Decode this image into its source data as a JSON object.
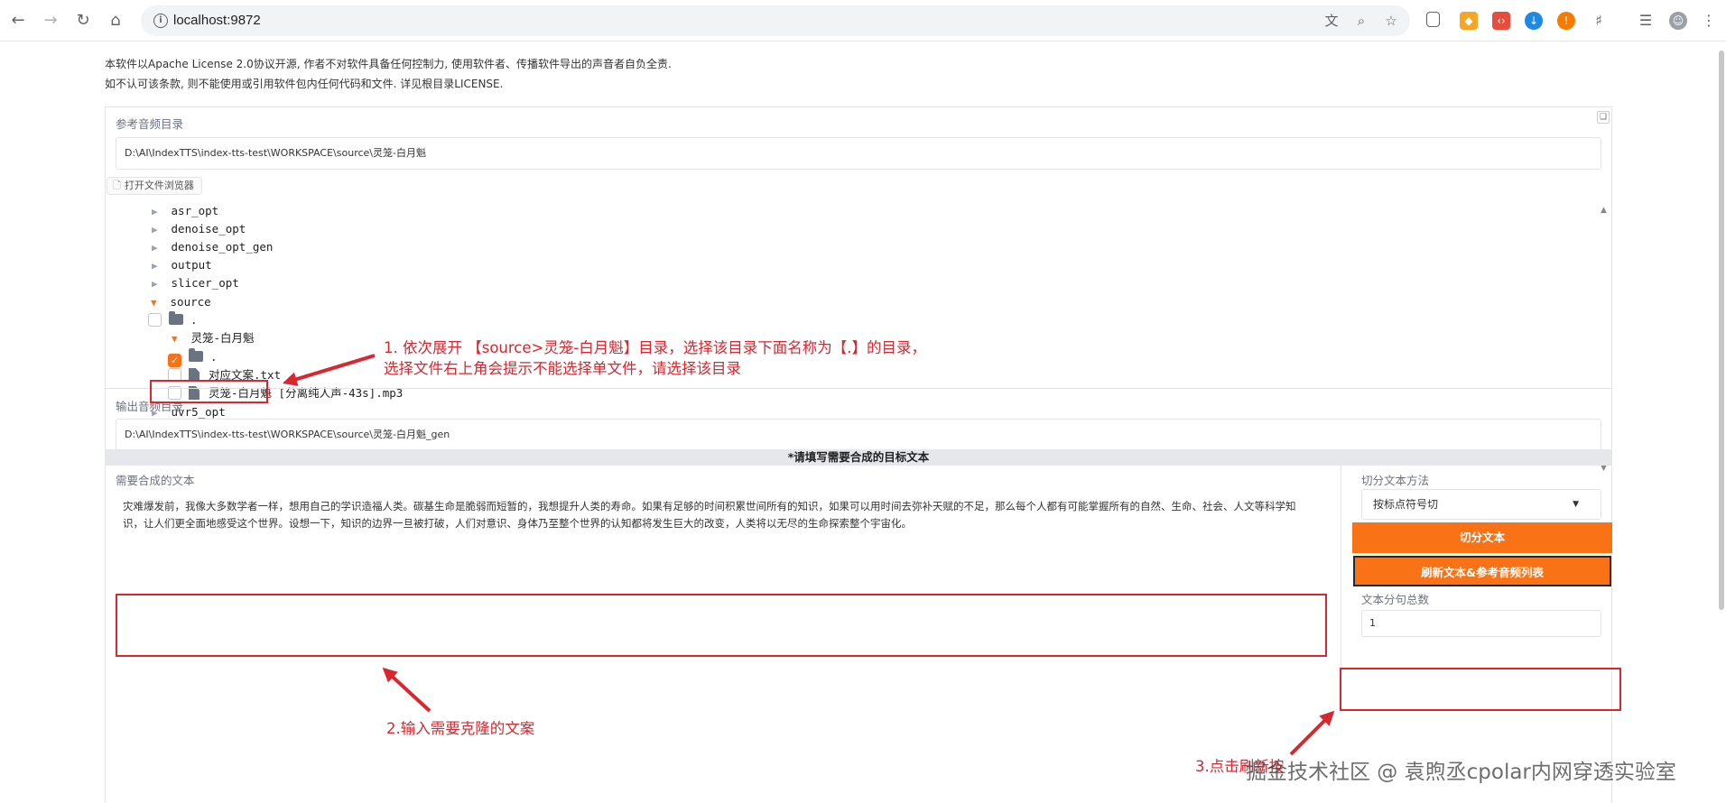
{
  "browser": {
    "url": "localhost:9872"
  },
  "license": {
    "line1": "本软件以Apache License 2.0协议开源, 作者不对软件具备任何控制力, 使用软件者、传播软件导出的声音者自负全责.",
    "line2": "如不认可该条款, 则不能使用或引用软件包内任何代码和文件. 详见根目录LICENSE."
  },
  "reference_dir": {
    "label": "参考音频目录",
    "value": "D:\\AI\\IndexTTS\\index-tts-test\\WORKSPACE\\source\\灵笼-白月魁",
    "browse_label": "打开文件浏览器"
  },
  "file_tree": [
    {
      "name": "asr_opt",
      "type": "collapsed"
    },
    {
      "name": "denoise_opt",
      "type": "collapsed"
    },
    {
      "name": "denoise_opt_gen",
      "type": "collapsed"
    },
    {
      "name": "output",
      "type": "collapsed"
    },
    {
      "name": "slicer_opt",
      "type": "collapsed"
    },
    {
      "name": "source",
      "type": "expanded"
    },
    {
      "name": ".",
      "type": "folder"
    },
    {
      "name": "灵笼-白月魁",
      "type": "expanded"
    },
    {
      "name": ".",
      "type": "folder-checked"
    },
    {
      "name": "对应文案.txt",
      "type": "file"
    },
    {
      "name": "灵笼-白月魁 [分离纯人声-43s].mp3",
      "type": "file"
    },
    {
      "name": "uvr5_opt",
      "type": "collapsed"
    }
  ],
  "output_dir": {
    "label": "输出音频目录",
    "value": "D:\\AI\\IndexTTS\\index-tts-test\\WORKSPACE\\source\\灵笼-白月魁_gen"
  },
  "section_title": "*请填写需要合成的目标文本",
  "synth_text": {
    "label": "需要合成的文本",
    "value": "灾难爆发前，我像大多数学者一样，想用自己的学识造福人类。碳基生命是脆弱而短暂的，我想提升人类的寿命。如果有足够的时间积累世间所有的知识，如果可以用时间去弥补天赋的不足，那么每个人都有可能掌握所有的自然、生命、社会、人文等科学知识，让人们更全面地感受这个世界。设想一下，知识的边界一旦被打破，人们对意识、身体乃至整个世界的认知都将发生巨大的改变，人类将以无尽的生命探索整个宇宙化。"
  },
  "split_method": {
    "label": "切分文本方法",
    "value": "按标点符号切"
  },
  "buttons": {
    "split": "切分文本",
    "refresh": "刷新文本&参考音频列表"
  },
  "segment_count": {
    "label": "文本分句总数",
    "value": "1"
  },
  "annotations": {
    "step1_line1": "1. 依次展开 【source>灵笼-白月魁】目录，选择该目录下面名称为【.】的目录，",
    "step1_line2": "选择文件右上角会提示不能选择单文件，请选择该目录",
    "step2": "2.输入需要克隆的文案",
    "step3": "3.点击刷新按"
  },
  "watermark": "掘金技术社区 @ 袁煦丞cpolar内网穿透实验室",
  "colors": {
    "accent": "#f97316",
    "annotation": "#d9262f"
  }
}
